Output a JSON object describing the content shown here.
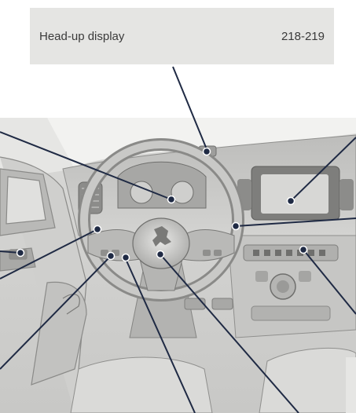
{
  "callout": {
    "label": "Head-up display",
    "pages": "218-219"
  },
  "illustration": {
    "subject": "vehicle-dashboard-interior",
    "brand_emblem": "lion-emblem"
  }
}
